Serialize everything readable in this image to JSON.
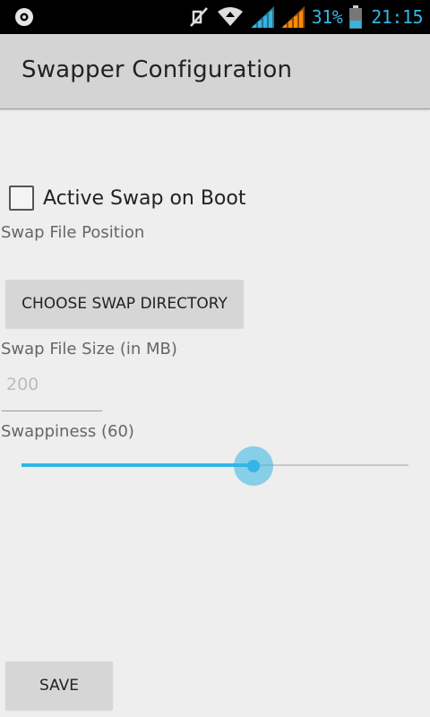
{
  "status_bar": {
    "battery_percent": "31%",
    "time": "21:15",
    "icons": [
      "settings-gear-icon",
      "mute-icon",
      "wifi-icon",
      "signal-blue-icon",
      "signal-orange-icon",
      "battery-icon"
    ],
    "accent_color": "#33b5e5"
  },
  "action_bar": {
    "title": "Swapper Configuration"
  },
  "form": {
    "active_swap_label": "Active Swap on Boot",
    "active_swap_checked": false,
    "swap_position_label": "Swap File Position",
    "choose_dir_button": "CHOOSE SWAP DIRECTORY",
    "swap_size_label": "Swap File Size (in MB)",
    "swap_size_value": "200",
    "swappiness_label": "Swappiness (60)",
    "swappiness_value": 60,
    "swappiness_max": 100,
    "save_button": "SAVE"
  }
}
